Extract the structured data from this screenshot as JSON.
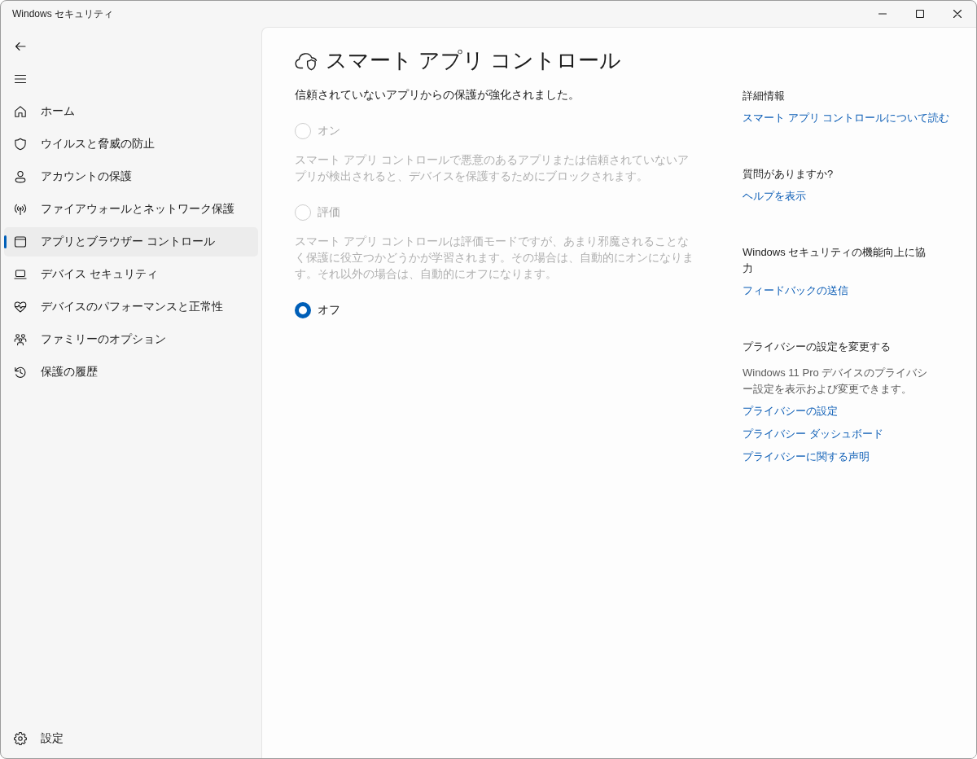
{
  "window": {
    "title": "Windows セキュリティ"
  },
  "nav": {
    "items": [
      {
        "label": "ホーム",
        "selected": false
      },
      {
        "label": "ウイルスと脅威の防止",
        "selected": false
      },
      {
        "label": "アカウントの保護",
        "selected": false
      },
      {
        "label": "ファイアウォールとネットワーク保護",
        "selected": false
      },
      {
        "label": "アプリとブラウザー コントロール",
        "selected": true
      },
      {
        "label": "デバイス セキュリティ",
        "selected": false
      },
      {
        "label": "デバイスのパフォーマンスと正常性",
        "selected": false
      },
      {
        "label": "ファミリーのオプション",
        "selected": false
      },
      {
        "label": "保護の履歴",
        "selected": false
      }
    ],
    "settings": {
      "label": "設定",
      "selected": false
    }
  },
  "page": {
    "title": "スマート アプリ コントロール",
    "subtitle": "信頼されていないアプリからの保護が強化されました。",
    "options": [
      {
        "label": "オン",
        "selected": false,
        "disabled": true,
        "description": "スマート アプリ コントロールで悪意のあるアプリまたは信頼されていないアプリが検出されると、デバイスを保護するためにブロックされます。"
      },
      {
        "label": "評価",
        "selected": false,
        "disabled": true,
        "description": "スマート アプリ コントロールは評価モードですが、あまり邪魔されることなく保護に役立つかどうかが学習されます。その場合は、自動的にオンになります。それ以外の場合は、自動的にオフになります。"
      },
      {
        "label": "オフ",
        "selected": true,
        "disabled": false
      }
    ]
  },
  "side_panel": {
    "sections": [
      {
        "heading": "詳細情報",
        "links": [
          "スマート アプリ コントロールについて読む"
        ]
      },
      {
        "heading": "質問がありますか?",
        "links": [
          "ヘルプを表示"
        ]
      },
      {
        "heading": "Windows セキュリティの機能向上に協力",
        "links": [
          "フィードバックの送信"
        ]
      },
      {
        "heading": "プライバシーの設定を変更する",
        "text": "Windows 11 Pro デバイスのプライバシー設定を表示および変更できます。",
        "links": [
          "プライバシーの設定",
          "プライバシー ダッシュボード",
          "プライバシーに関する声明"
        ]
      }
    ]
  }
}
